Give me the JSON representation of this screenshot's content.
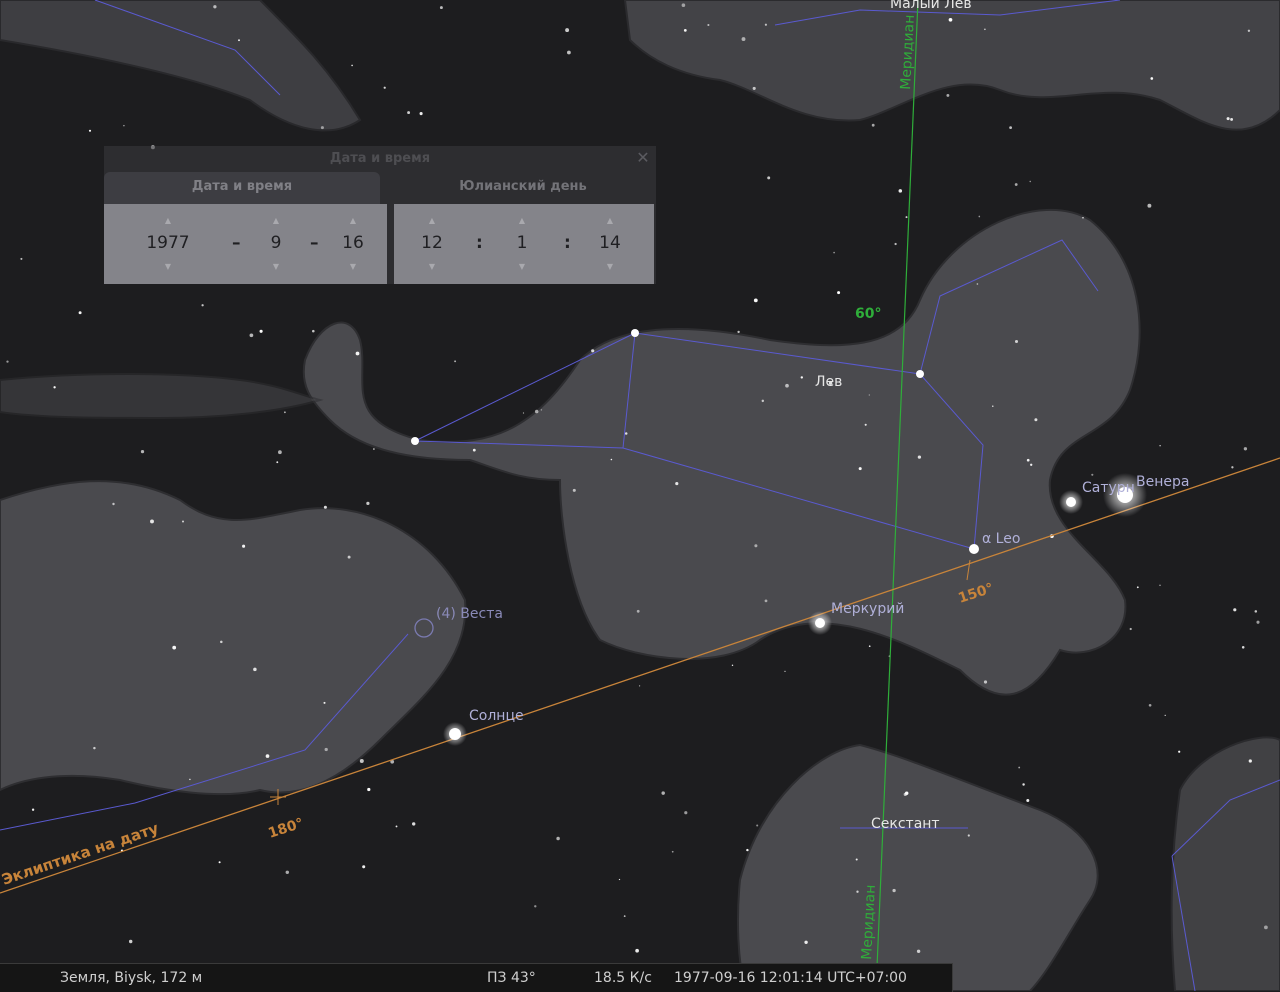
{
  "dialog": {
    "title": "Дата и время",
    "close_label": "✕",
    "tabs": [
      {
        "label": "Дата и время"
      },
      {
        "label": "Юлианский день"
      }
    ],
    "date": {
      "year": "1977",
      "month": "9",
      "day": "16",
      "sep": "–"
    },
    "time": {
      "hour": "12",
      "minute": "1",
      "second": "14",
      "sep": ":"
    },
    "spin_up": "▲",
    "spin_down": "▼"
  },
  "sky_labels": {
    "meridian_top": "Меридиан",
    "meridian_bottom": "Меридиан",
    "leo_minor": "Малый Лев",
    "leo": "Лев",
    "sextant": "Секстант",
    "alpha_leo": "α Leo",
    "saturn": "Сатурн",
    "venus": "Венера",
    "mercury": "Меркурий",
    "vesta": "(4) Веста",
    "sun": "Солнце",
    "ecliptic": "Эклиптика на дату",
    "alt_60": "60°",
    "lon_150": "150°",
    "lon_180": "180°"
  },
  "colors": {
    "meridian": "#2fae3a",
    "ecliptic": "#c8843a",
    "constellation_lines": "#5a5ad0",
    "planet_label": "#b0b0d8",
    "label": "#e6e6e6"
  },
  "status": {
    "location": "Земля, Biysk, 172 м",
    "fov": "ПЗ 43°",
    "fps": "18.5 К/с",
    "datetime": "1977-09-16 12:01:14 UTC+07:00"
  }
}
